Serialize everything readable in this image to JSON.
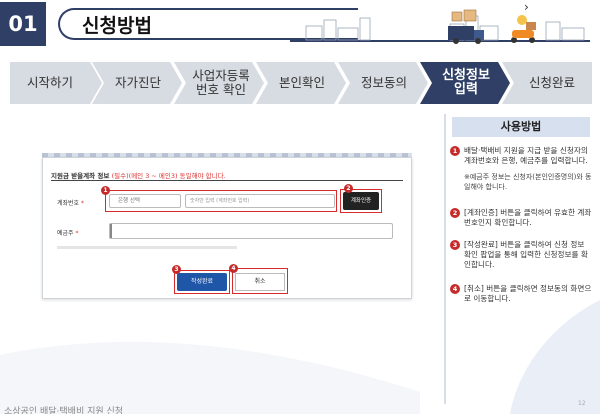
{
  "header": {
    "badge": "01",
    "title": "신청방법"
  },
  "steps": [
    {
      "label": "시작하기",
      "active": false
    },
    {
      "label": "자가진단",
      "active": false
    },
    {
      "label": "사업자등록\n번호 확인",
      "active": false
    },
    {
      "label": "본인확인",
      "active": false
    },
    {
      "label": "정보동의",
      "active": false
    },
    {
      "label": "신청정보\n입력",
      "active": true
    },
    {
      "label": "신청완료",
      "active": false
    }
  ],
  "colors": {
    "navy": "#2f3f66",
    "step_bg": "#d7dbe2",
    "step_active": "#2f3f66",
    "highlight": "#d82a2a",
    "primary_button": "#1f56a8"
  },
  "form": {
    "title": "지원금 받을계좌 정보",
    "title_note": "(필수)(메인 3 ~ 메인3) 동일해야 합니다.",
    "account_label": "계좌번호",
    "required_mark": "*",
    "bank_select": "은행 선택",
    "account_placeholder": "숫자만 입력 (계좌번호 입력)",
    "verify_button": "계좌인증",
    "holder_label": "예금주",
    "complete_button": "작성완료",
    "cancel_button": "취소",
    "markers": [
      "1",
      "2",
      "3",
      "4"
    ]
  },
  "guide": {
    "title": "사용방법",
    "items": [
      {
        "n": "1",
        "text": "배달·택배비 지원을 지급 받을 신청자의 계좌번호와 은행, 예금주를 입력합니다.",
        "sub": "※예금주 정보는 신청자(본인인증명의)와 동일해야 합니다."
      },
      {
        "n": "2",
        "text": "[계좌인증] 버튼을 클릭하여 유효한 계좌번호인지 확인합니다.",
        "sub": ""
      },
      {
        "n": "3",
        "text": "[작성완료] 버튼을 클릭하여 신청 정보 확인 팝업을 통해 입력한 신청정보를 확인합니다.",
        "sub": ""
      },
      {
        "n": "4",
        "text": "[취소] 버튼을 클릭하면 정보동의 화면으로 이동합니다.",
        "sub": ""
      }
    ]
  },
  "footer": {
    "text": "소상공인 배달·택배비 지원 신청",
    "page": "12"
  }
}
